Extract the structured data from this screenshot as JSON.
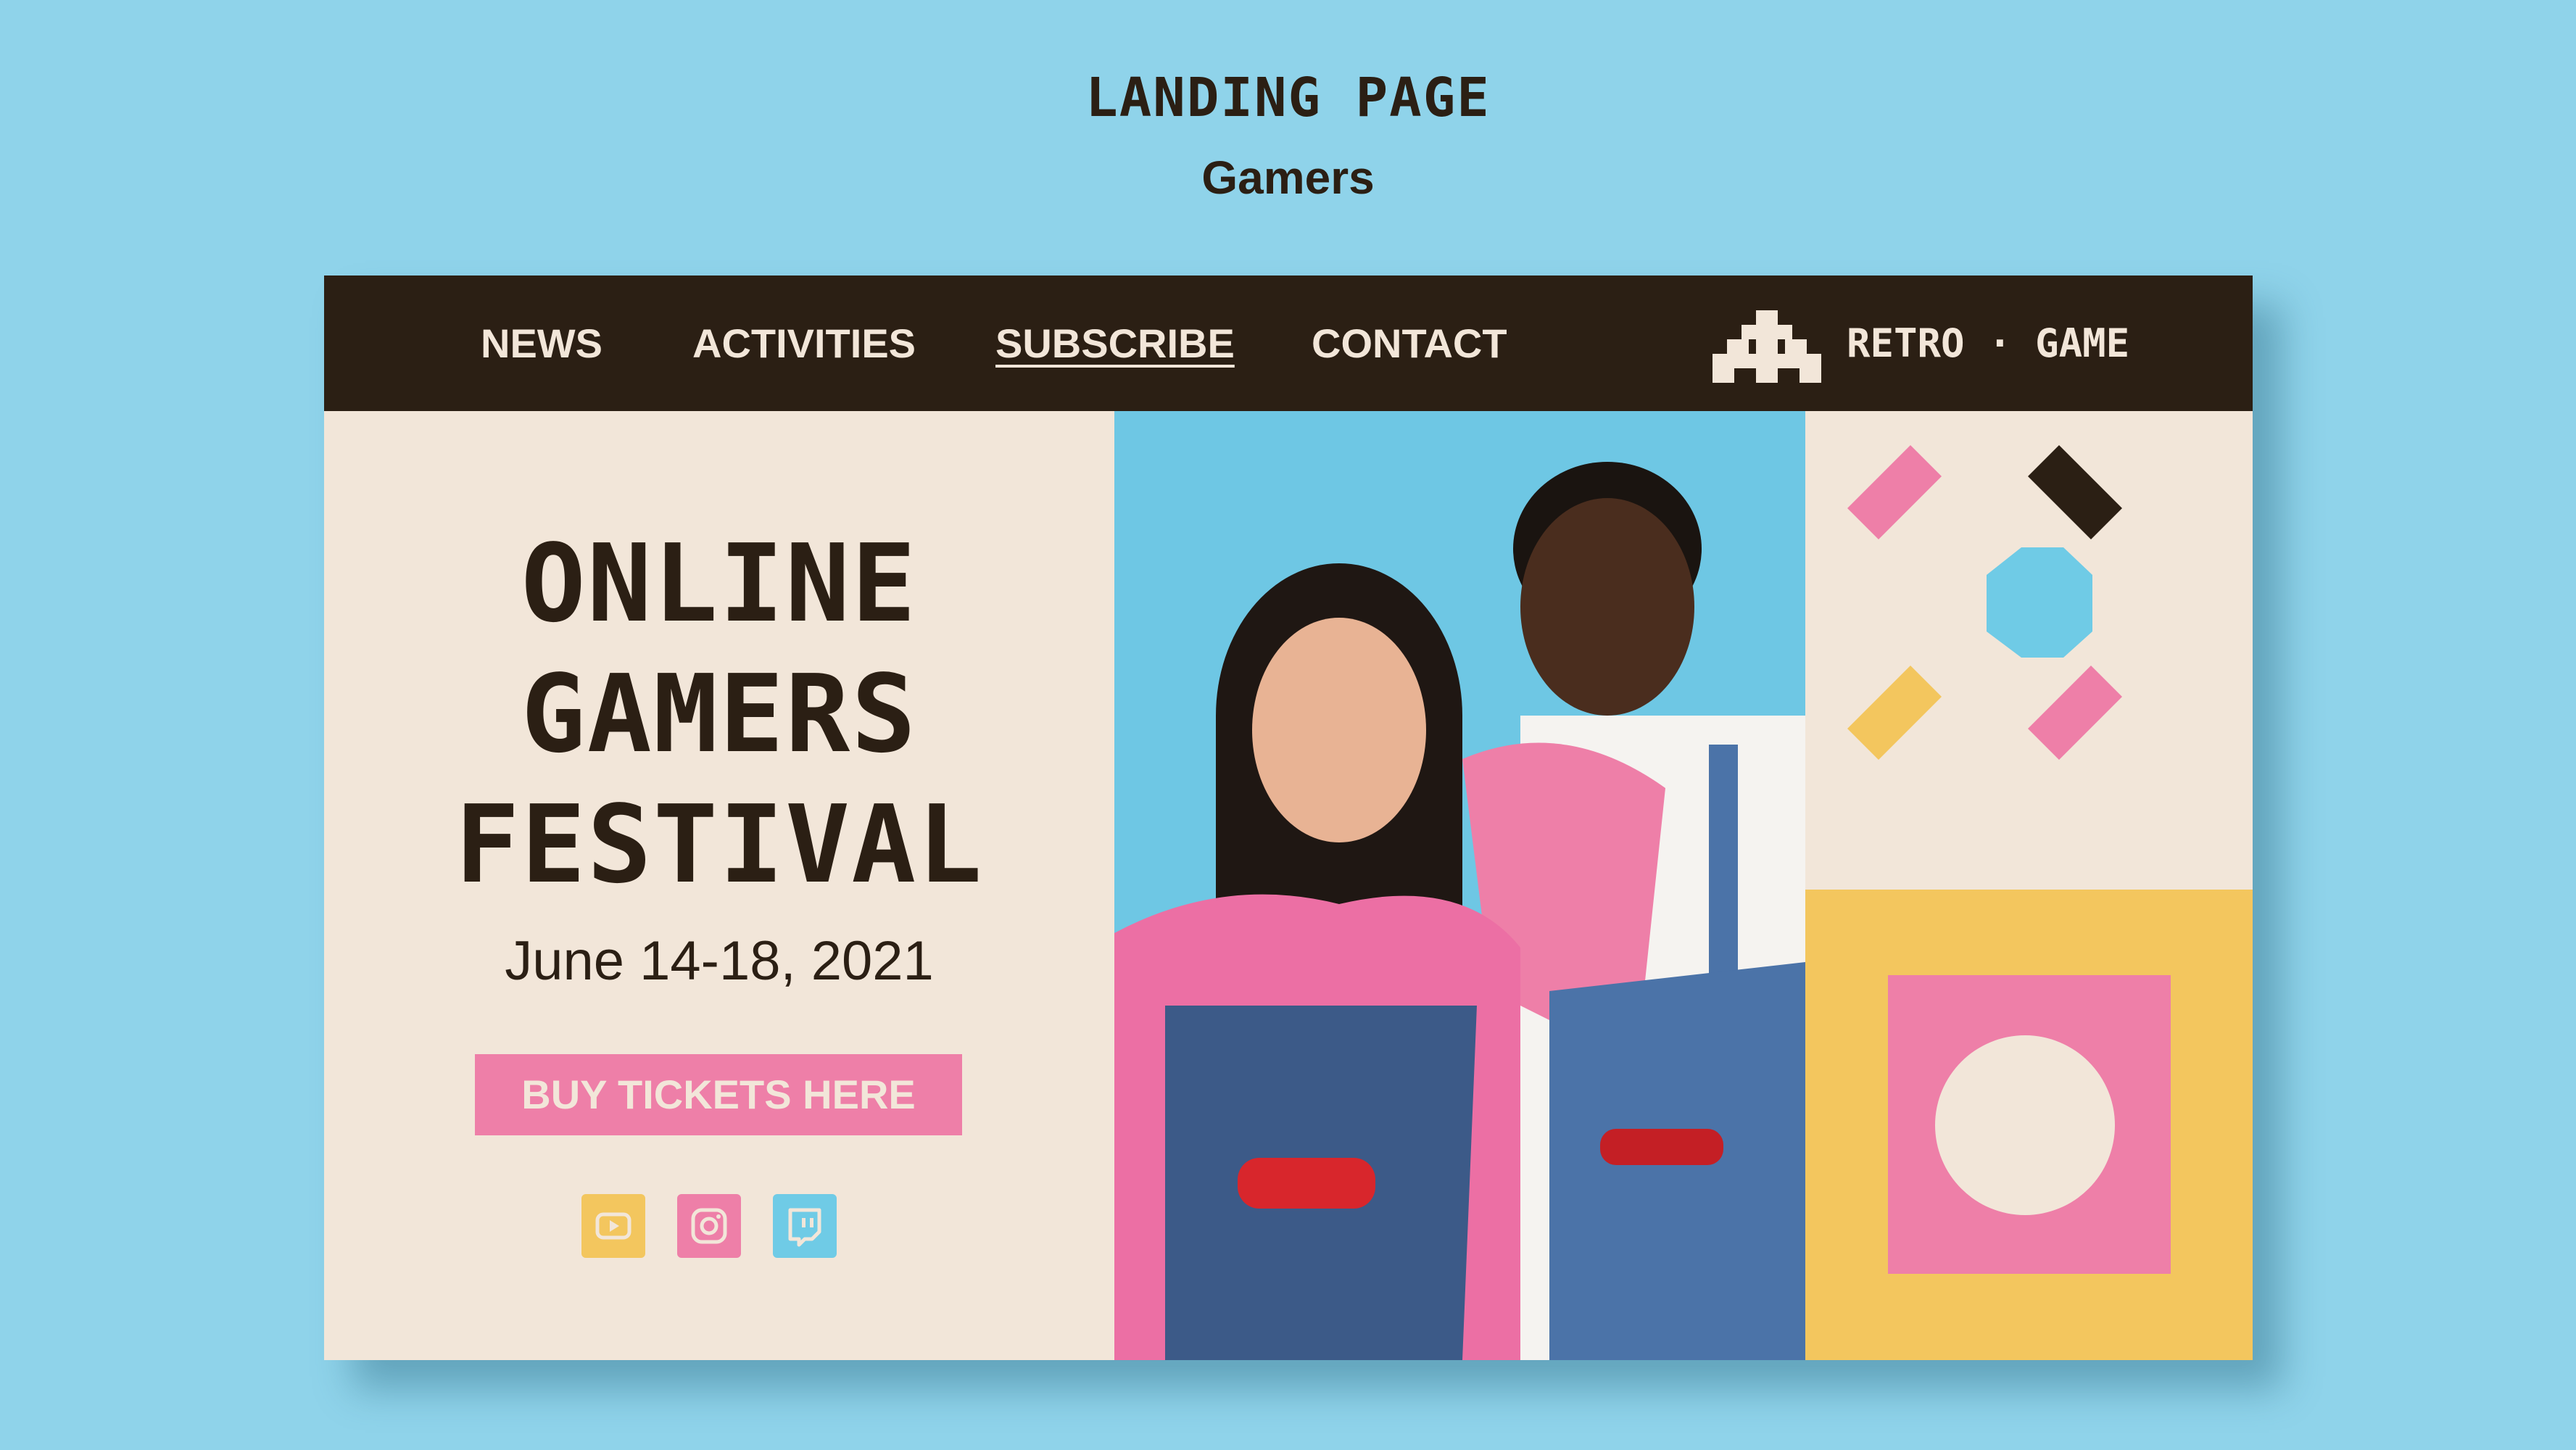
{
  "page_caption": {
    "title": "LANDING PAGE",
    "subtitle": "Gamers"
  },
  "navbar": {
    "links": [
      {
        "label": "NEWS",
        "active": false
      },
      {
        "label": "ACTIVITIES",
        "active": false
      },
      {
        "label": "SUBSCRIBE",
        "active": true
      },
      {
        "label": "CONTACT",
        "active": false
      }
    ],
    "brand": {
      "icon": "space-invader-icon",
      "name": "RETRO · GAME"
    }
  },
  "hero": {
    "title_lines": [
      "ONLINE",
      "GAMERS",
      "FESTIVAL"
    ],
    "date": "June 14-18, 2021",
    "cta_label": "BUY TICKETS HERE"
  },
  "social": [
    {
      "name": "youtube",
      "icon": "youtube-icon",
      "color": "#f3c65e"
    },
    {
      "name": "instagram",
      "icon": "instagram-icon",
      "color": "#ee7fa8"
    },
    {
      "name": "twitch",
      "icon": "twitch-icon",
      "color": "#6fcbe6"
    }
  ],
  "colors": {
    "background": "#8fd3ea",
    "dark": "#2b1f14",
    "cream": "#f2e6d9",
    "pink": "#ee7fa8",
    "yellow": "#f3c65e",
    "blue": "#6fcbe6"
  }
}
